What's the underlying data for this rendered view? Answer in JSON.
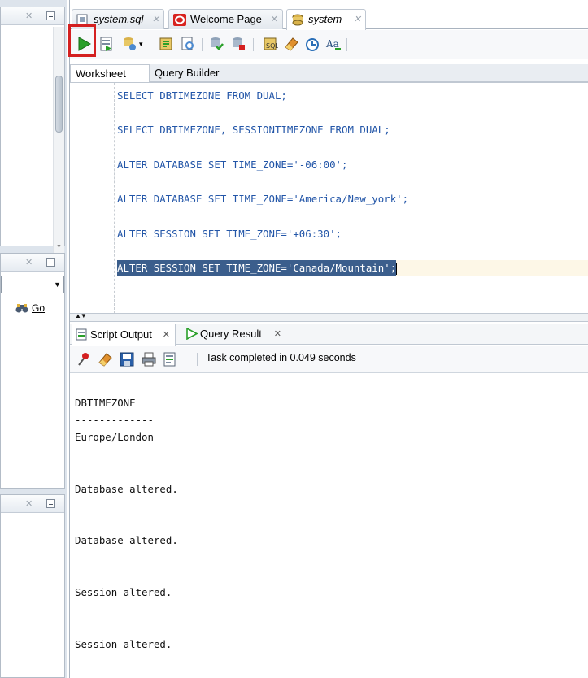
{
  "editor_tabs": [
    {
      "label": "system.sql",
      "icon": "sql-file-icon"
    },
    {
      "label": "Welcome Page",
      "icon": "oracle-logo-icon"
    },
    {
      "label": "system",
      "icon": "database-connection-icon"
    }
  ],
  "sub_tabs": {
    "worksheet": "Worksheet",
    "query_builder": "Query Builder"
  },
  "left_panel": {
    "go_label": "Go"
  },
  "editor_lines": [
    "SELECT DBTIMEZONE FROM DUAL;",
    "SELECT DBTIMEZONE, SESSIONTIMEZONE FROM DUAL;",
    "ALTER DATABASE SET TIME_ZONE='-06:00';",
    "ALTER DATABASE SET TIME_ZONE='America/New_york';",
    "ALTER SESSION SET TIME_ZONE='+06:30';",
    "ALTER SESSION SET TIME_ZONE='Canada/Mountain';"
  ],
  "output_tabs": {
    "script_output": "Script Output",
    "query_result": "Query Result"
  },
  "output_status": "Task completed in 0.049 seconds",
  "output_lines": [
    "DBTIMEZONE",
    "-------------",
    "Europe/London",
    "Database altered.",
    "Database altered.",
    "Session altered.",
    "Session altered."
  ],
  "colors": {
    "accent": "#2356a8",
    "selection": "#3b5e8c",
    "highlight_box": "#d42020",
    "run_green": "#2aa02a"
  }
}
